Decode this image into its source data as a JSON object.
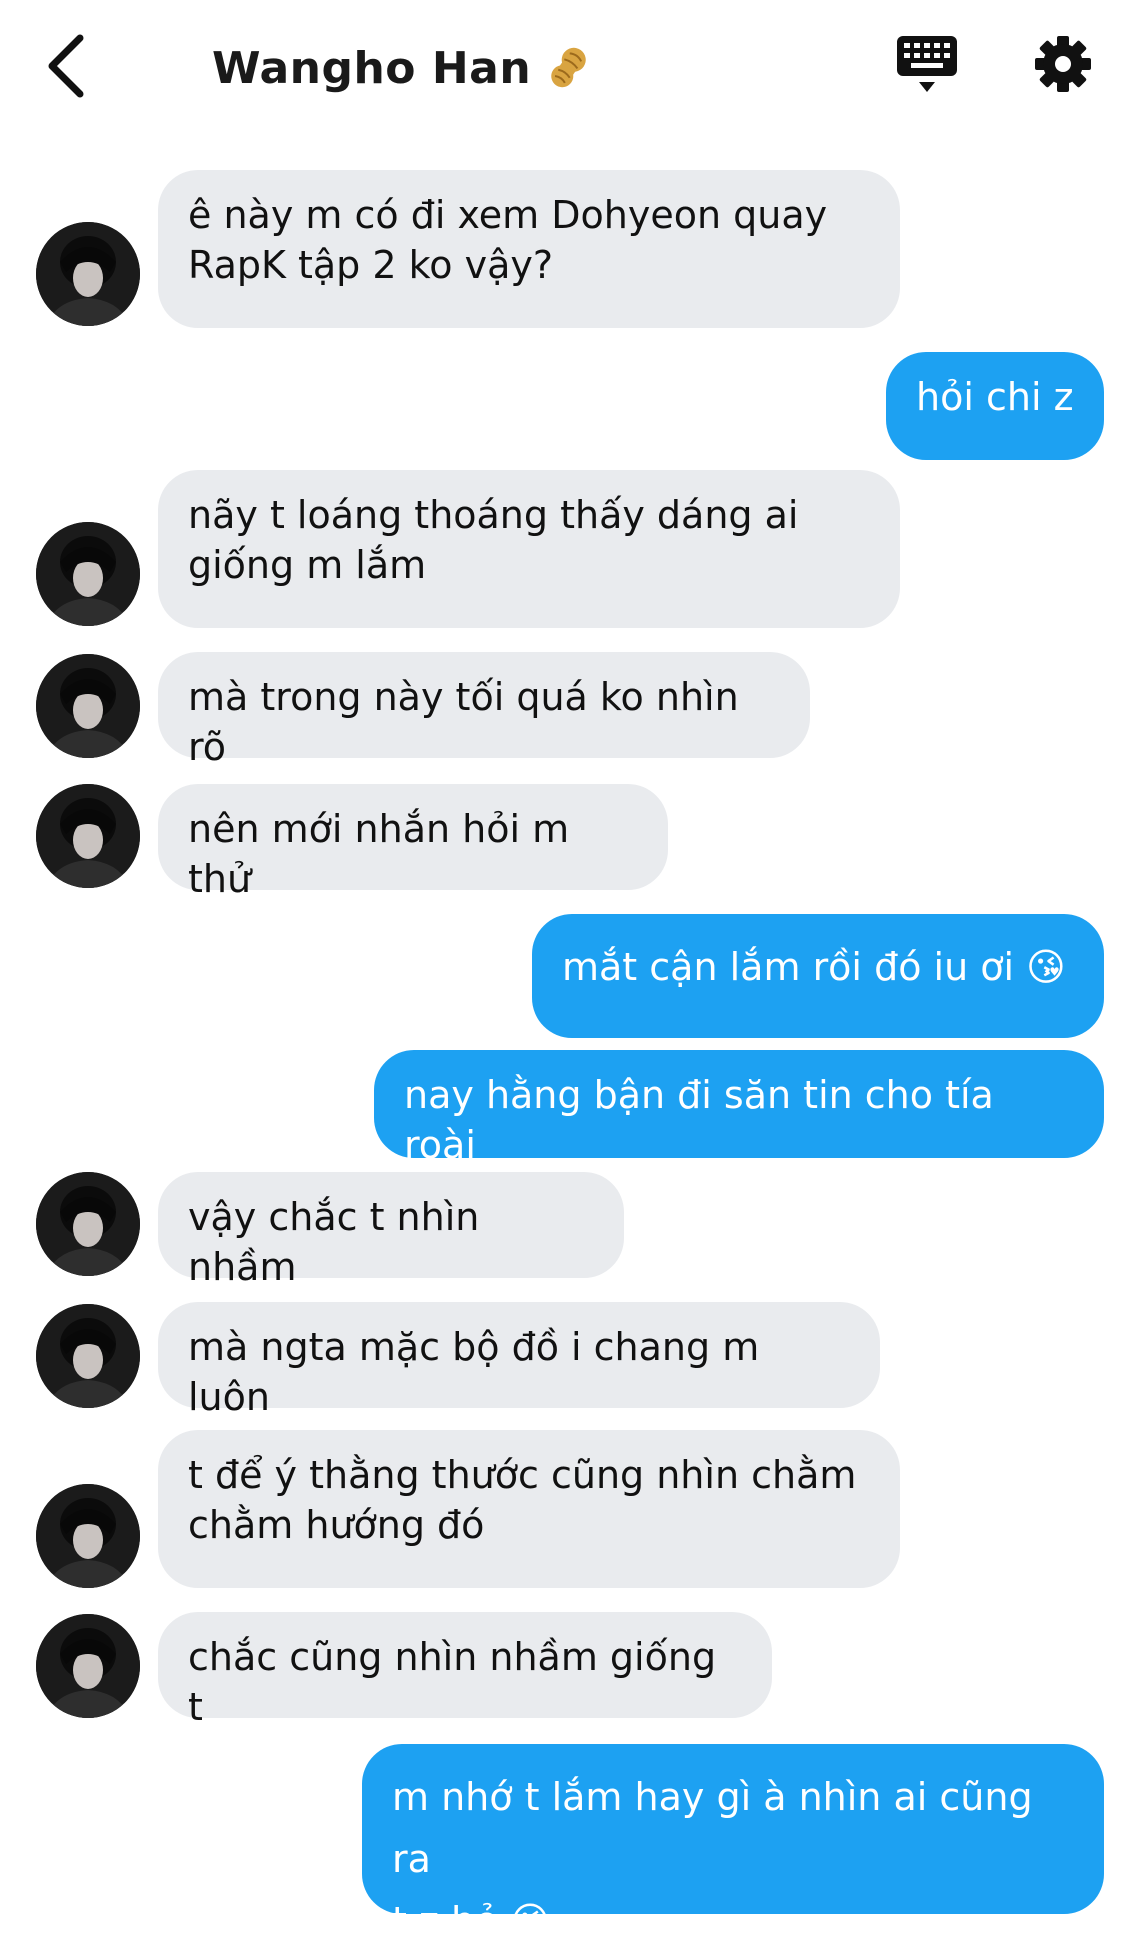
{
  "header": {
    "title": "Wangho Han",
    "title_emoji_icon": "peanut-icon",
    "back_icon": "chevron-left-icon",
    "keyboard_icon": "keyboard-icon",
    "settings_icon": "gear-icon"
  },
  "colors": {
    "outgoing_bubble": "#1da1f2",
    "incoming_bubble": "#e9ebee",
    "text_dark": "#111111",
    "text_light": "#ffffff"
  },
  "messages": [
    {
      "side": "in",
      "text": "ê này m có đi xem Dohyeon quay\nRapK tập 2 ko vậy?"
    },
    {
      "side": "out",
      "text": "hỏi chi z"
    },
    {
      "side": "in",
      "text": "nãy t loáng thoáng thấy dáng ai\ngiống m lắm"
    },
    {
      "side": "in",
      "text": "mà trong này tối quá ko nhìn rõ"
    },
    {
      "side": "in",
      "text": "nên mới nhắn hỏi m thử"
    },
    {
      "side": "out",
      "text": "mắt cận lắm rồi đó iu ơi 😘"
    },
    {
      "side": "out",
      "text": "nay hằng bận đi săn tin cho tía roài"
    },
    {
      "side": "in",
      "text": "vậy chắc t nhìn nhầm"
    },
    {
      "side": "in",
      "text": "mà ngta mặc bộ đồ i chang m luôn"
    },
    {
      "side": "in",
      "text": "t để ý thằng thước cũng nhìn chằm\nchằm hướng đó"
    },
    {
      "side": "in",
      "text": "chắc cũng nhìn nhầm giống t"
    },
    {
      "side": "out",
      "text": "m nhớ t lắm hay gì à nhìn ai cũng ra\nt z hỏ 😘"
    }
  ]
}
